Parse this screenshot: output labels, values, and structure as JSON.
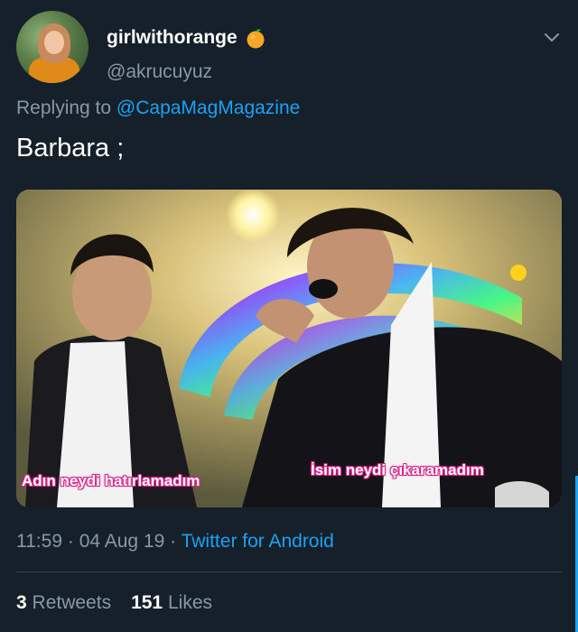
{
  "tweet": {
    "display_name": "girlwithorange",
    "name_emoji_icon": "orange-icon",
    "handle": "@akrucuyuz",
    "menu_icon": "chevron-down-icon",
    "reply_prefix": "Replying to",
    "reply_to": "@CapaMagMagazine",
    "text": "Barbara ;",
    "media": {
      "caption_left": "Adın neydi hatırlamadım",
      "caption_right": "İsim neydi çıkaramadım"
    },
    "time": "11:59",
    "date": "04 Aug 19",
    "separator": "·",
    "source": "Twitter for Android",
    "retweets_count": "3",
    "retweets_label": "Retweets",
    "likes_count": "151",
    "likes_label": "Likes"
  },
  "colors": {
    "background": "#15202b",
    "primary_text": "#ffffff",
    "secondary_text": "#8899a6",
    "link": "#1da1f2",
    "divider": "#38444d",
    "caption_outline": "#d8238a"
  }
}
